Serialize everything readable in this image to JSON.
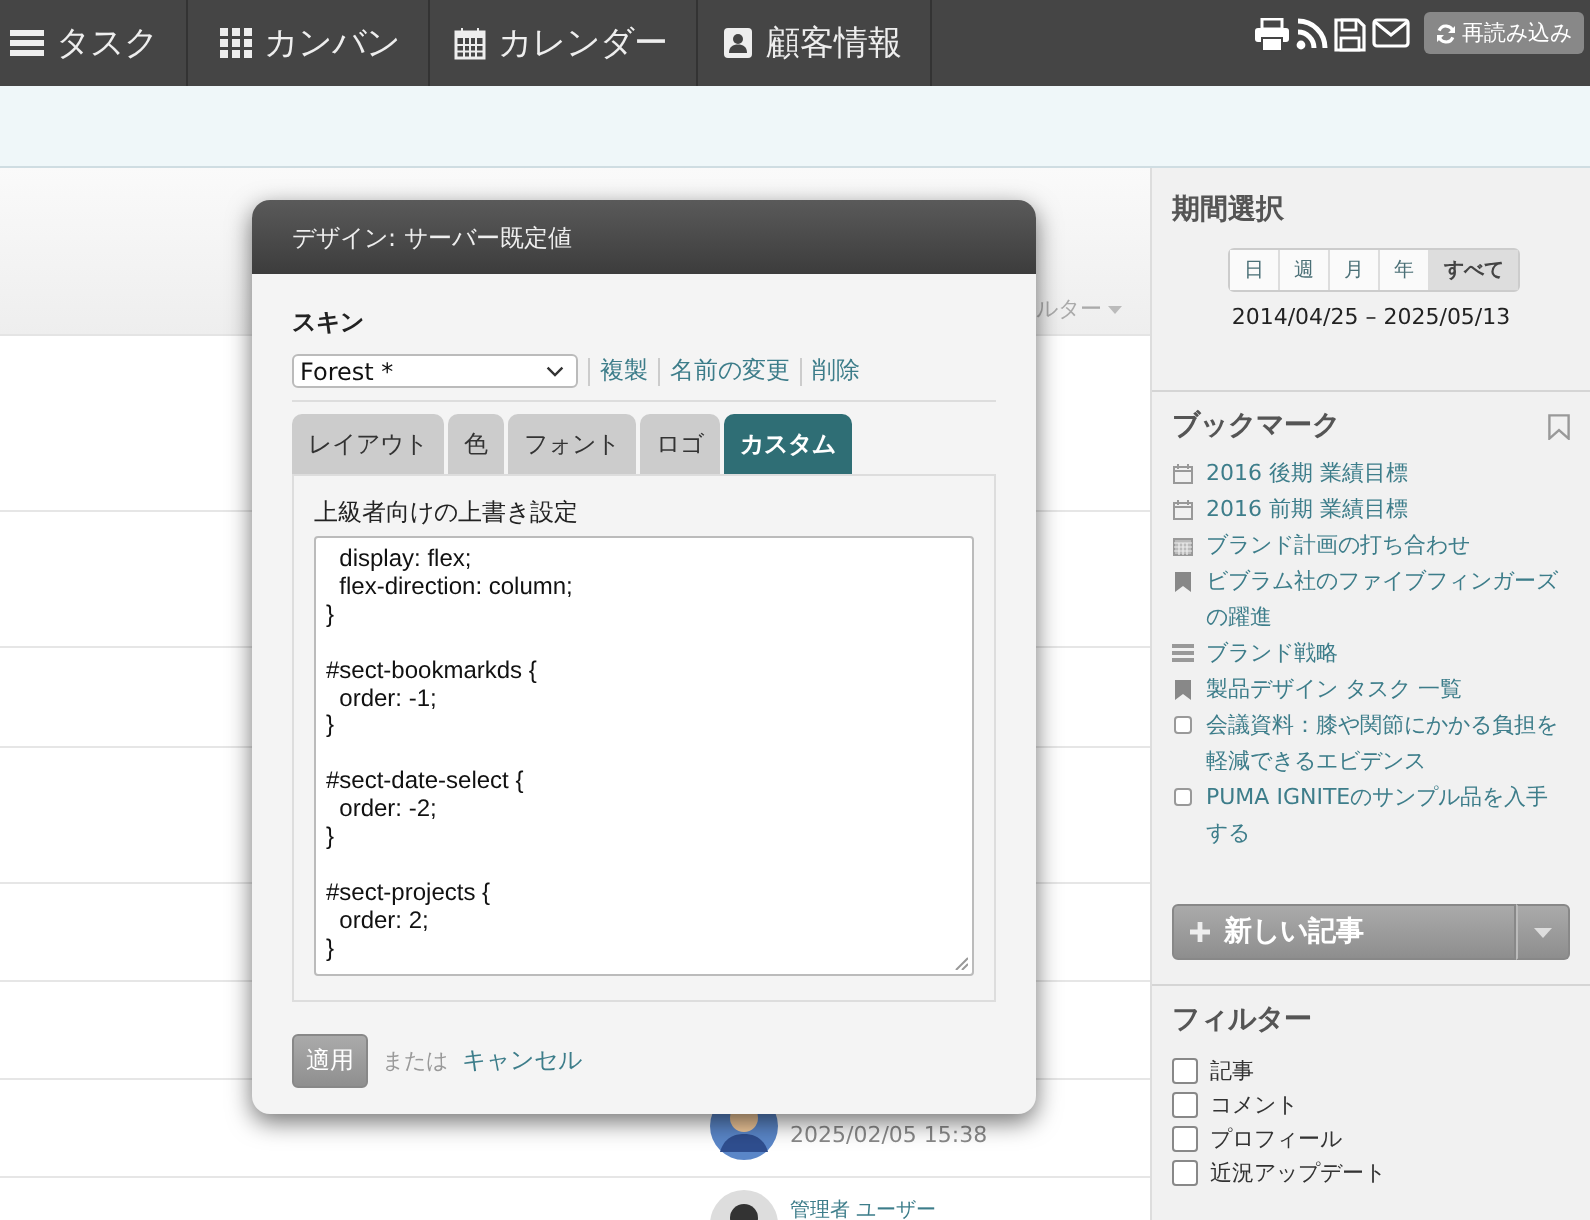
{
  "nav": {
    "items": [
      {
        "label": "タスク",
        "kind": "list"
      },
      {
        "label": "カンバン",
        "kind": "grid"
      },
      {
        "label": "カレンダー",
        "kind": "calendar"
      },
      {
        "label": "顧客情報",
        "kind": "contact"
      }
    ],
    "reload_button": "再読み込み"
  },
  "main": {
    "filter_label": "ルター",
    "posts": [
      {
        "time": "2025/02/05 15:38"
      },
      {
        "author": "管理者 ユーザー"
      }
    ]
  },
  "dialog": {
    "title": "デザイン: サーバー既定値",
    "skin_label": "スキン",
    "skin_value": "Forest *",
    "skin_actions": [
      "複製",
      "名前の変更",
      "削除"
    ],
    "tabs": [
      {
        "label": "レイアウト",
        "selected": false
      },
      {
        "label": "色",
        "selected": false
      },
      {
        "label": "フォント",
        "selected": false
      },
      {
        "label": "ロゴ",
        "selected": false
      },
      {
        "label": "カスタム",
        "selected": true
      }
    ],
    "override_label": "上級者向けの上書き設定",
    "css_value": "  display: flex;\n  flex-direction: column;\n}\n\n#sect-bookmarkds {\n  order: -1;\n}\n\n#sect-date-select {\n  order: -2;\n}\n\n#sect-projects {\n  order: 2;\n}",
    "apply_button": "適用",
    "or_text": "または",
    "cancel_link": "キャンセル"
  },
  "sidebar": {
    "period_title": "期間選択",
    "periods": [
      {
        "label": "日",
        "selected": false
      },
      {
        "label": "週",
        "selected": false
      },
      {
        "label": "月",
        "selected": false
      },
      {
        "label": "年",
        "selected": false
      },
      {
        "label": "すべて",
        "selected": true
      }
    ],
    "date_range": "2014/04/25 – 2025/05/13",
    "bookmarks_title": "ブックマーク",
    "bookmarks": [
      {
        "label": "2016 後期 業績目標",
        "kind": "calendar"
      },
      {
        "label": "2016 前期 業績目標",
        "kind": "calendar"
      },
      {
        "label": "ブランド計画の打ち合わせ",
        "kind": "event"
      },
      {
        "label": "ビブラム社のファイブフィンガーズの躍進",
        "kind": "bookmark"
      },
      {
        "label": "ブランド戦略",
        "kind": "list"
      },
      {
        "label": "製品デザイン タスク 一覧",
        "kind": "bookmark"
      },
      {
        "label": "会議資料：膝や関節にかかる負担を軽減できるエビデンス",
        "kind": "task"
      },
      {
        "label": "PUMA IGNITEのサンプル品を入手する",
        "kind": "task"
      }
    ],
    "new_post_button": "新しい記事",
    "filter_title": "フィルター",
    "filters": [
      {
        "label": "記事",
        "checked": false
      },
      {
        "label": "コメント",
        "checked": false
      },
      {
        "label": "プロフィール",
        "checked": false
      },
      {
        "label": "近況アップデート",
        "checked": false
      }
    ]
  }
}
